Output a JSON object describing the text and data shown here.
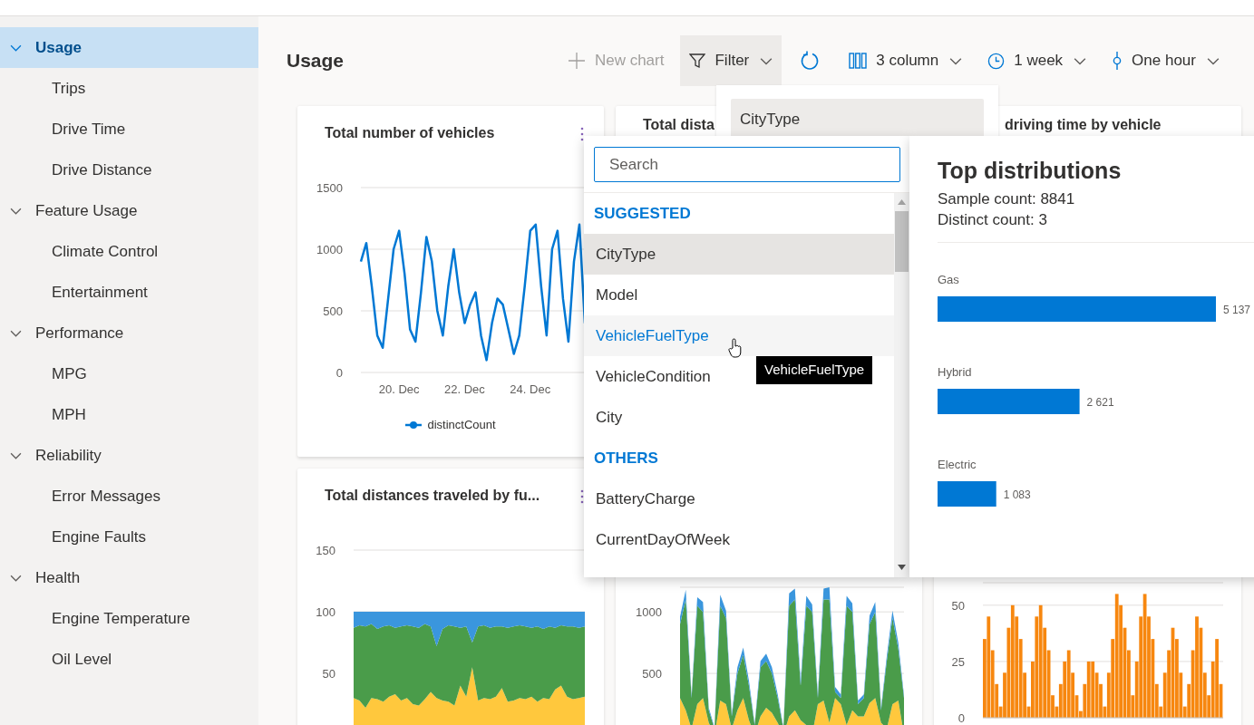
{
  "sidebar": {
    "items": [
      {
        "label": "Usage",
        "expanded": true,
        "selected": true,
        "children": [
          {
            "label": "Trips",
            "selected": false
          },
          {
            "label": "Drive Time",
            "selected": false
          },
          {
            "label": "Drive Distance",
            "selected": false
          }
        ]
      },
      {
        "label": "Feature Usage",
        "expanded": true,
        "selected": false,
        "children": [
          {
            "label": "Climate Control",
            "selected": false
          },
          {
            "label": "Entertainment",
            "selected": false
          }
        ]
      },
      {
        "label": "Performance",
        "expanded": true,
        "selected": false,
        "children": [
          {
            "label": "MPG",
            "selected": false
          },
          {
            "label": "MPH",
            "selected": false
          }
        ]
      },
      {
        "label": "Reliability",
        "expanded": true,
        "selected": false,
        "children": [
          {
            "label": "Error Messages",
            "selected": false
          },
          {
            "label": "Engine Faults",
            "selected": false
          }
        ]
      },
      {
        "label": "Health",
        "expanded": true,
        "selected": false,
        "children": [
          {
            "label": "Engine Temperature",
            "selected": false
          },
          {
            "label": "Oil Level",
            "selected": false
          }
        ]
      }
    ]
  },
  "page_title": "Usage",
  "toolbar": [
    {
      "kind": "new",
      "label": "New chart",
      "disabled": true,
      "open": false
    },
    {
      "kind": "filter",
      "label": "Filter",
      "disabled": false,
      "open": true
    },
    {
      "kind": "refresh"
    },
    {
      "kind": "columns",
      "label": "3 column",
      "disabled": false,
      "open": false
    },
    {
      "kind": "time",
      "label": "1 week",
      "disabled": false,
      "open": false
    },
    {
      "kind": "interval",
      "label": "One hour",
      "disabled": false,
      "open": false
    }
  ],
  "cards": [
    {
      "title": "Total number of vehicles",
      "chart_data": {
        "type": "line",
        "categories": [
          null,
          null,
          null,
          null,
          null,
          null,
          null,
          "20. Dec",
          null,
          null,
          null,
          null,
          null,
          null,
          null,
          null,
          null,
          null,
          null,
          "22. Dec",
          null,
          null,
          null,
          null,
          null,
          null,
          null,
          null,
          null,
          null,
          null,
          "24. Dec",
          null,
          null,
          null,
          null,
          null,
          null,
          null,
          null,
          null,
          null
        ],
        "ylim": [
          0,
          1500
        ],
        "yticks": [
          0,
          500,
          1000,
          1500
        ],
        "series": [
          {
            "name": "distinctCount",
            "color": "#0078d4",
            "values": [
              900,
              1050,
              700,
              300,
              200,
              600,
              1000,
              1150,
              800,
              350,
              250,
              650,
              1100,
              900,
              500,
              300,
              700,
              1000,
              650,
              400,
              550,
              650,
              300,
              100,
              400,
              600,
              550,
              350,
              150,
              300,
              700,
              1150,
              1200,
              700,
              300,
              1000,
              1150,
              600,
              250,
              900,
              1200,
              400
            ]
          }
        ]
      }
    },
    {
      "title": "Total dista"
    },
    {
      "title": "driving time by vehicle"
    },
    {
      "title": "Total distances traveled by fu...",
      "chart_data": {
        "type": "area",
        "stacked": true,
        "ylim": [
          0,
          150
        ],
        "yticks": [
          50,
          100,
          150
        ],
        "series": [
          {
            "color": "#ffc83d",
            "values": [
              30,
              28,
              22,
              30,
              29,
              27,
              31,
              33,
              28,
              30,
              25,
              24,
              29,
              35,
              30,
              28,
              27,
              24,
              40,
              31,
              55,
              28,
              30,
              29,
              31,
              38,
              27,
              28,
              30,
              29,
              31,
              27,
              30,
              29,
              37,
              40,
              31,
              29,
              30,
              31
            ]
          },
          {
            "color": "#4a9c4a",
            "values": [
              57,
              61,
              66,
              60,
              57,
              61,
              58,
              54,
              60,
              59,
              63,
              63,
              61,
              53,
              42,
              58,
              62,
              64,
              47,
              57,
              20,
              60,
              59,
              58,
              57,
              50,
              60,
              60,
              59,
              59,
              56,
              61,
              56,
              59,
              50,
              49,
              57,
              59,
              57,
              57
            ]
          },
          {
            "color": "#3a96dd",
            "values": [
              13,
              11,
              12,
              10,
              14,
              12,
              11,
              13,
              12,
              11,
              12,
              13,
              10,
              12,
              28,
              14,
              11,
              12,
              13,
              12,
              25,
              12,
              11,
              13,
              12,
              12,
              13,
              12,
              11,
              12,
              13,
              12,
              14,
              12,
              13,
              11,
              12,
              12,
              13,
              12
            ]
          }
        ]
      }
    },
    {
      "chart_data": {
        "type": "area",
        "stacked": true,
        "ylim": [
          0,
          1200
        ],
        "yticks": [
          500,
          1000
        ],
        "series": [
          {
            "color": "#ffc83d",
            "values": [
              300,
              200,
              50,
              250,
              300,
              100,
              0,
              280,
              250,
              50,
              200,
              300,
              120,
              0,
              150,
              220,
              180,
              100,
              0,
              150,
              200,
              120,
              80,
              0,
              250,
              280,
              100,
              300,
              250,
              80,
              200,
              150,
              150,
              260,
              300,
              100,
              50,
              250,
              280,
              0
            ]
          },
          {
            "color": "#4a9c4a",
            "values": [
              600,
              900,
              250,
              800,
              700,
              100,
              50,
              770,
              700,
              100,
              300,
              350,
              280,
              80,
              400,
              380,
              320,
              200,
              50,
              900,
              900,
              280,
              970,
              1000,
              50,
              820,
              1000,
              50,
              50,
              970,
              800,
              100,
              150,
              640,
              700,
              100,
              550,
              700,
              420,
              300
            ]
          },
          {
            "color": "#3a96dd",
            "values": [
              60,
              80,
              20,
              70,
              80,
              20,
              10,
              90,
              60,
              20,
              50,
              60,
              40,
              10,
              50,
              60,
              50,
              30,
              10,
              100,
              90,
              40,
              80,
              60,
              30,
              90,
              100,
              40,
              30,
              80,
              70,
              30,
              30,
              70,
              80,
              20,
              40,
              60,
              50,
              20
            ]
          }
        ]
      }
    },
    {
      "chart_data": {
        "type": "bar",
        "ylim": [
          0,
          60
        ],
        "yticks": [
          0,
          25,
          50
        ],
        "series": [
          {
            "color": "#f7870f",
            "values": [
              35,
              45,
              30,
              15,
              5,
              20,
              40,
              50,
              45,
              35,
              20,
              5,
              25,
              45,
              50,
              40,
              30,
              10,
              5,
              15,
              25,
              30,
              20,
              10,
              3,
              15,
              25,
              25,
              20,
              15,
              5,
              20,
              35,
              55,
              50,
              40,
              30,
              10,
              25,
              45,
              55,
              45,
              35,
              15,
              5,
              20,
              30,
              40,
              35,
              20,
              5,
              15,
              30,
              45,
              40,
              20,
              10,
              25,
              35,
              15
            ]
          }
        ]
      }
    }
  ],
  "filter_dropdown": {
    "field_value": "CityType"
  },
  "property_picker": {
    "search_placeholder": "Search",
    "sections": [
      {
        "header": "SUGGESTED",
        "items": [
          {
            "label": "CityType",
            "selected": true,
            "hovered": false
          },
          {
            "label": "Model",
            "selected": false,
            "hovered": false
          },
          {
            "label": "VehicleFuelType",
            "selected": false,
            "hovered": true
          },
          {
            "label": "VehicleCondition",
            "selected": false,
            "hovered": false
          },
          {
            "label": "City",
            "selected": false,
            "hovered": false
          }
        ]
      },
      {
        "header": "OTHERS",
        "items": [
          {
            "label": "BatteryCharge",
            "selected": false,
            "hovered": false
          },
          {
            "label": "CurrentDayOfWeek",
            "selected": false,
            "hovered": false
          }
        ]
      }
    ],
    "tooltip": "VehicleFuelType"
  },
  "distribution": {
    "title": "Top distributions",
    "sample_count": "Sample count: 8841",
    "distinct_count": "Distinct count: 3",
    "chart_data": {
      "type": "bar",
      "orientation": "horizontal",
      "categories": [
        "Gas",
        "Hybrid",
        "Electric"
      ],
      "values": [
        5137,
        2621,
        1083
      ],
      "data_labels": true
    }
  }
}
